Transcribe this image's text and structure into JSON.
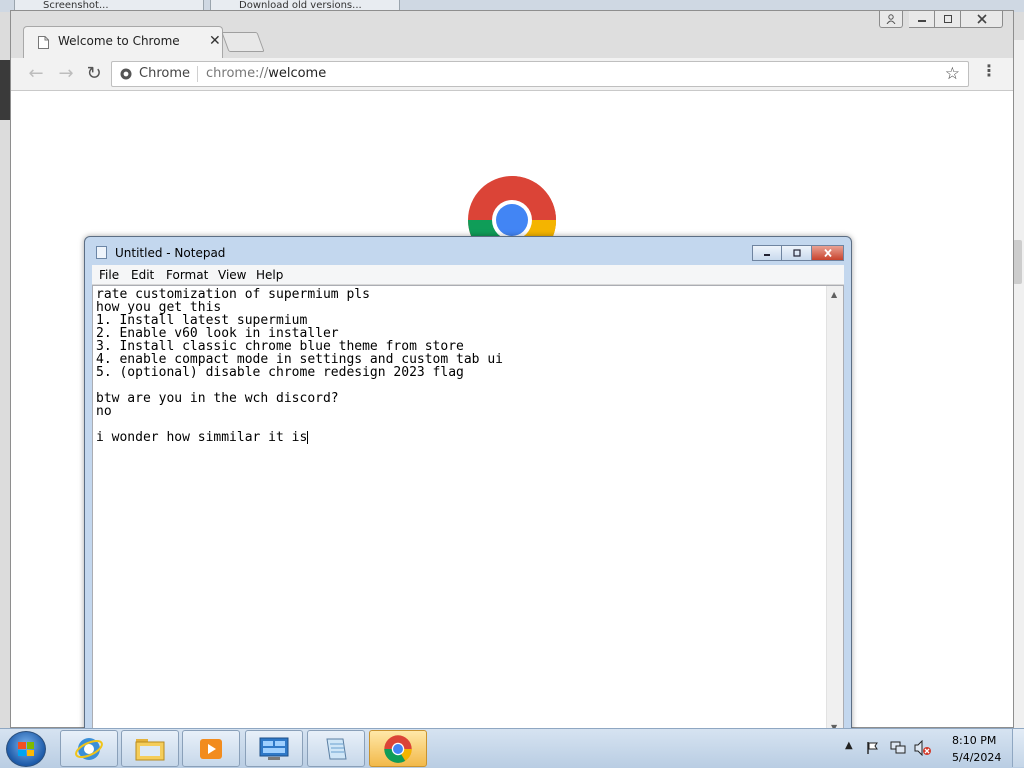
{
  "background_window": {
    "tabs": [
      "Screenshot...",
      "Download old versions..."
    ]
  },
  "chrome": {
    "tab_title": "Welcome to Chrome",
    "omnibox": {
      "site_label": "Chrome",
      "url_scheme": "chrome://",
      "url_host": "welcome"
    },
    "icons": {
      "back": "back-arrow-icon",
      "forward": "forward-arrow-icon",
      "reload": "reload-icon",
      "star": "bookmark-star-icon",
      "menu": "kebab-menu-icon"
    }
  },
  "notepad": {
    "title": "Untitled - Notepad",
    "menu": [
      "File",
      "Edit",
      "Format",
      "View",
      "Help"
    ],
    "text_lines": [
      "rate customization of supermium pls",
      "how you get this",
      "1. Install latest supermium",
      "2. Enable v60 look in installer",
      "3. Install classic chrome blue theme from store",
      "4. enable compact mode in settings and custom tab ui",
      "5. (optional) disable chrome redesign 2023 flag",
      "",
      "btw are you in the wch discord?",
      "no",
      "",
      "i wonder how simmilar it is"
    ]
  },
  "taskbar": {
    "pinned": [
      "internet-explorer",
      "file-explorer",
      "media-player",
      "control-panel",
      "notepad",
      "chrome"
    ],
    "active_item": "chrome",
    "clock": {
      "time": "8:10 PM",
      "date": "5/4/2024"
    }
  },
  "colors": {
    "chrome_tabstrip": "#dedede",
    "notepad_frame": "#c3d7ee",
    "taskbar": "#c7d8ea",
    "close_red": "#c8432d"
  }
}
